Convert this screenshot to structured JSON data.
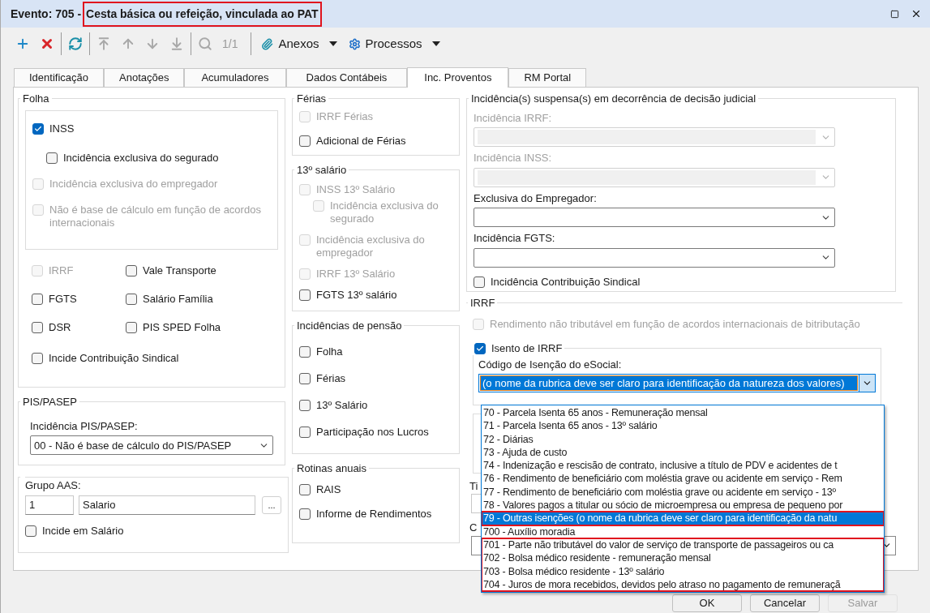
{
  "window": {
    "title_prefix": "Evento: 705 - ",
    "title": "Cesta básica ou refeição, vinculada ao PAT",
    "title_highlighted": true
  },
  "toolbar": {
    "button_groups": [
      [
        {
          "kind": "add",
          "disabled": false
        },
        {
          "kind": "delete",
          "disabled": false
        }
      ],
      [
        {
          "kind": "refresh",
          "disabled": false
        }
      ],
      [
        {
          "kind": "first",
          "disabled": true
        },
        {
          "kind": "up",
          "disabled": true
        },
        {
          "kind": "down",
          "disabled": true
        },
        {
          "kind": "last",
          "disabled": true
        }
      ],
      [
        {
          "kind": "search",
          "disabled": true
        }
      ]
    ],
    "record_counter": "1/1",
    "menus": [
      {
        "kind": "clip",
        "label": "Anexos"
      },
      {
        "kind": "gear",
        "label": "Processos"
      }
    ]
  },
  "tabs": [
    {
      "label": "Identificação",
      "selected": false
    },
    {
      "label": "Anotações",
      "selected": false
    },
    {
      "label": "Acumuladores",
      "selected": false
    },
    {
      "label": "Dados Contábeis",
      "selected": false
    },
    {
      "label": "Inc. Proventos",
      "selected": true
    },
    {
      "label": "RM Portal",
      "selected": false
    }
  ],
  "folha": {
    "title": "Folha",
    "inner": [
      {
        "label": "INSS",
        "checked": true,
        "disabled": false,
        "children": [
          {
            "label": "Incidência exclusiva do segurado",
            "checked": false,
            "disabled": false
          }
        ]
      },
      {
        "label": "Incidência exclusiva do empregador",
        "checked": false,
        "disabled": true
      },
      {
        "label": "Não é base de cálculo em função de acordos internacionais",
        "checked": false,
        "disabled": true
      }
    ],
    "grid": [
      {
        "label": "IRRF",
        "checked": false,
        "disabled": true
      },
      {
        "label": "Vale Transporte",
        "checked": false,
        "disabled": false
      },
      {
        "label": "FGTS",
        "checked": false,
        "disabled": false
      },
      {
        "label": "Salário Família",
        "checked": false,
        "disabled": false
      },
      {
        "label": "DSR",
        "checked": false,
        "disabled": false
      },
      {
        "label": "PIS SPED Folha",
        "checked": false,
        "disabled": false
      }
    ],
    "extra": [
      {
        "label": "Incide Contribuição Sindical",
        "checked": false,
        "disabled": false
      }
    ]
  },
  "pis_pasep": {
    "title": "PIS/PASEP",
    "label": "Incidência PIS/PASEP:",
    "value": "00 - Não é base de cálculo do PIS/PASEP"
  },
  "grupo_aas": {
    "label": "Grupo AAS:",
    "code": "1",
    "name": "Salario",
    "lookup_button": "...",
    "checkbox": {
      "label": "Incide em Salário",
      "checked": false,
      "disabled": false
    }
  },
  "ferias": {
    "title": "Férias",
    "items": [
      {
        "label": "IRRF Férias",
        "checked": false,
        "disabled": true
      },
      {
        "label": "Adicional de Férias",
        "checked": false,
        "disabled": false
      }
    ]
  },
  "decimo": {
    "title": "13º salário",
    "items": [
      {
        "label": "INSS 13º Salário",
        "checked": false,
        "disabled": true,
        "children": [
          {
            "label": "Incidência exclusiva do segurado",
            "checked": false,
            "disabled": true
          }
        ]
      },
      {
        "label": "Incidência exclusiva do empregador",
        "checked": false,
        "disabled": true
      },
      {
        "label": "IRRF 13º Salário",
        "checked": false,
        "disabled": true
      },
      {
        "label": "FGTS 13º salário",
        "checked": false,
        "disabled": false
      }
    ]
  },
  "pensao": {
    "title": "Incidências de pensão",
    "items": [
      {
        "label": "Folha",
        "checked": false,
        "disabled": false
      },
      {
        "label": "Férias",
        "checked": false,
        "disabled": false
      },
      {
        "label": "13º Salário",
        "checked": false,
        "disabled": false
      },
      {
        "label": "Participação nos Lucros",
        "checked": false,
        "disabled": false
      }
    ]
  },
  "rotinas": {
    "title": "Rotinas anuais",
    "items": [
      {
        "label": "RAIS",
        "checked": false,
        "disabled": false
      },
      {
        "label": "Informe de Rendimentos",
        "checked": false,
        "disabled": false
      }
    ]
  },
  "suspensas": {
    "title": "Incidência(s) suspensa(s) em decorrência de decisão judicial",
    "combos": [
      {
        "label": "Incidência IRRF:",
        "disabled": true
      },
      {
        "label": "Incidência INSS:",
        "disabled": true
      },
      {
        "label": "Exclusiva do Empregador:",
        "disabled": false
      },
      {
        "label": "Incidência FGTS:",
        "disabled": false
      }
    ],
    "checkbox": {
      "label": "Incidência Contribuição Sindical",
      "checked": false,
      "disabled": false
    }
  },
  "irrf": {
    "title": "IRRF",
    "rendimento": {
      "label": "Rendimento não tributável em função de acordos internacionais de bitributação",
      "checked": false,
      "disabled": true
    },
    "isento": {
      "label": "Isento de IRRF",
      "checked": true,
      "disabled": false
    },
    "codigo_label": "Código de Isenção do eSocial:",
    "codigo_value": "(o nome da rubrica deve ser claro para identificação da natureza dos valores)",
    "hidden_labels": [
      "Ti",
      "C"
    ]
  },
  "dropdown": {
    "option_groups": [
      {
        "marked": false,
        "options": [
          {
            "label": "70 - Parcela Isenta 65 anos - Remuneração mensal",
            "selected": false
          },
          {
            "label": "71 - Parcela Isenta 65 anos - 13º salário",
            "selected": false
          },
          {
            "label": "72 - Diárias",
            "selected": false
          },
          {
            "label": "73 - Ajuda de custo",
            "selected": false
          },
          {
            "label": "74 - Indenização e rescisão de contrato, inclusive a título de PDV e acidentes de t",
            "selected": false
          },
          {
            "label": "76 - Rendimento de beneficiário com moléstia grave ou acidente em serviço - Rem",
            "selected": false
          },
          {
            "label": "77 - Rendimento de beneficiário com moléstia grave ou acidente em serviço - 13º",
            "selected": false
          },
          {
            "label": "78 - Valores pagos a titular ou sócio de microempresa ou empresa de pequeno por",
            "selected": false
          }
        ]
      },
      {
        "marked": true,
        "options": [
          {
            "label": "79 - Outras isenções (o nome da rubrica deve ser claro para identificação da natu",
            "selected": true
          }
        ]
      },
      {
        "marked": false,
        "options": [
          {
            "label": "700 - Auxílio moradia",
            "selected": false
          }
        ]
      },
      {
        "marked": true,
        "options": [
          {
            "label": "701 - Parte não tributável do valor de serviço de transporte de passageiros ou ca",
            "selected": false
          },
          {
            "label": "702 - Bolsa médico residente - remuneração mensal",
            "selected": false
          },
          {
            "label": "703 - Bolsa médico residente - 13º salário",
            "selected": false
          },
          {
            "label": "704 - Juros de mora recebidos, devidos pelo atraso no pagamento de remuneraçã",
            "selected": false
          }
        ]
      }
    ]
  },
  "footer_buttons": [
    {
      "label": "OK",
      "disabled": false
    },
    {
      "label": "Cancelar",
      "disabled": false
    },
    {
      "label": "Salvar",
      "disabled": true
    }
  ]
}
